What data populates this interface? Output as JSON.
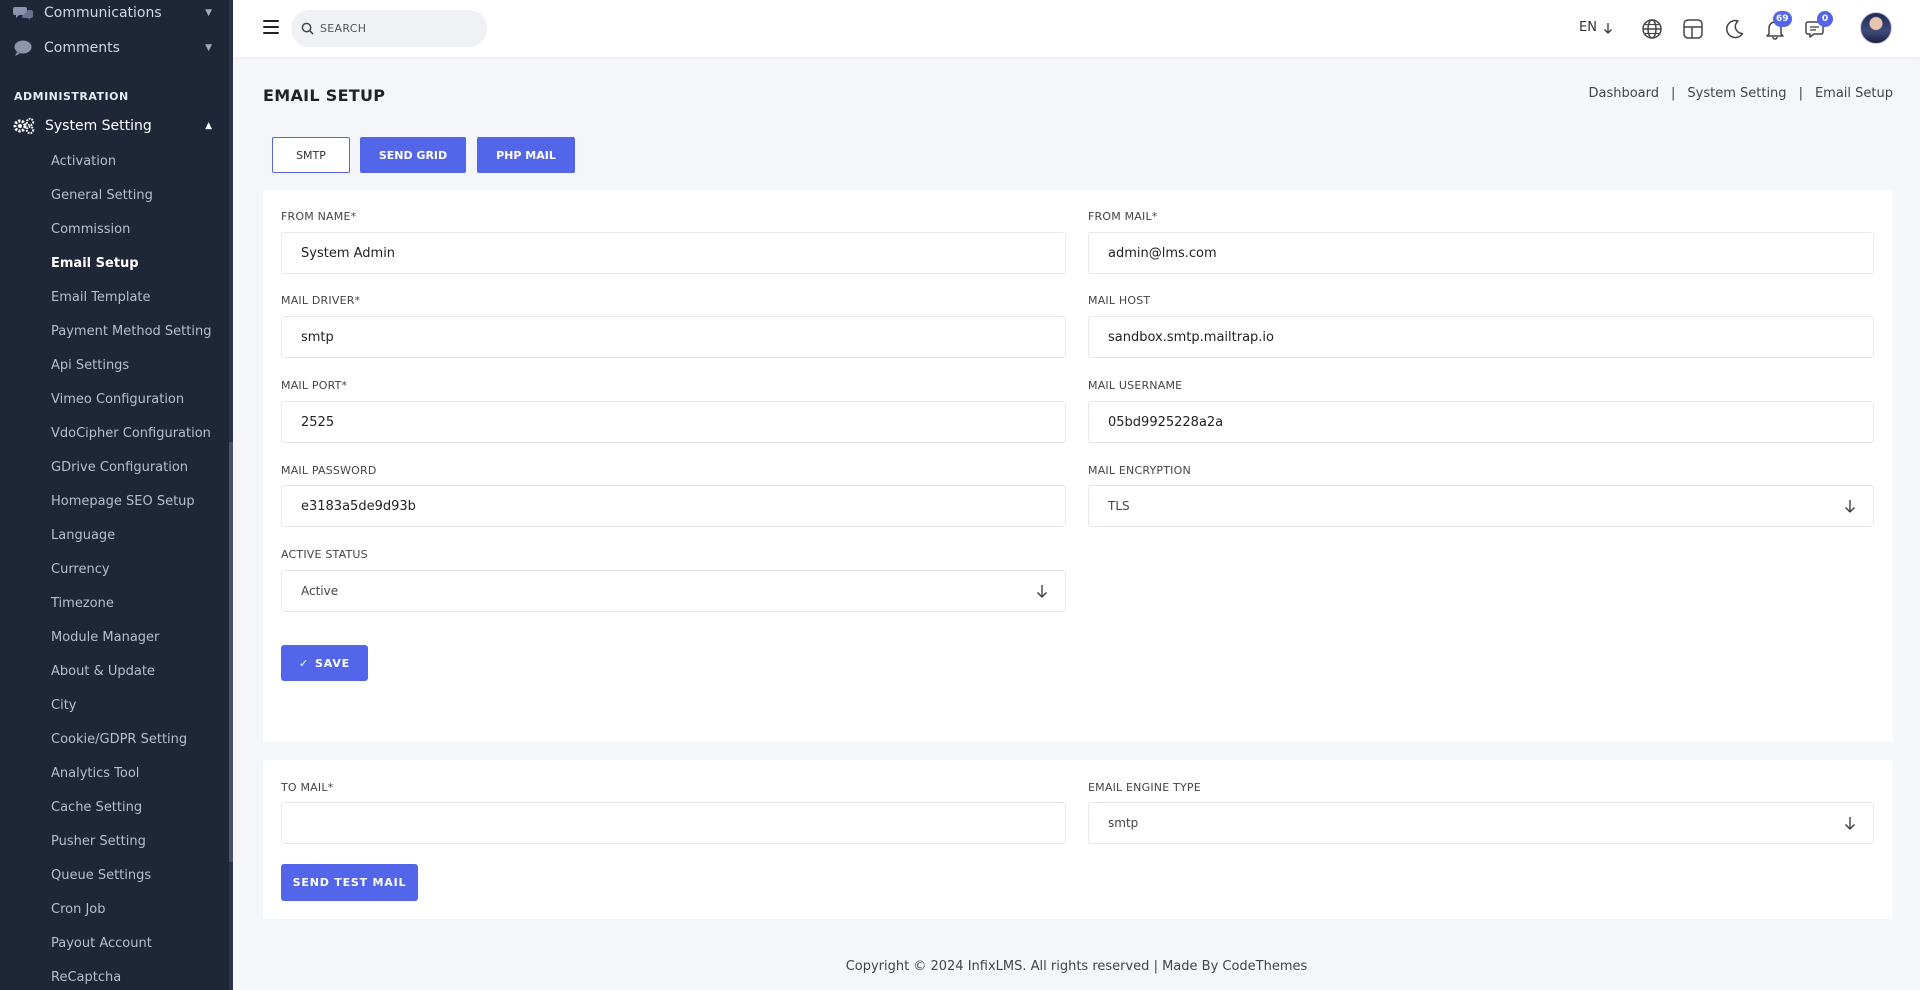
{
  "sidebar": {
    "top_items": [
      {
        "label": "Communications",
        "icon": "chat-bubbles-icon"
      },
      {
        "label": "Comments",
        "icon": "comment-icon"
      }
    ],
    "section_label": "ADMINISTRATION",
    "parent": {
      "label": "System Setting",
      "icon": "gears-icon"
    },
    "items": [
      {
        "label": "Activation"
      },
      {
        "label": "General Setting"
      },
      {
        "label": "Commission"
      },
      {
        "label": "Email Setup",
        "active": true
      },
      {
        "label": "Email Template"
      },
      {
        "label": "Payment Method Setting"
      },
      {
        "label": "Api Settings"
      },
      {
        "label": "Vimeo Configuration"
      },
      {
        "label": "VdoCipher Configuration"
      },
      {
        "label": "GDrive Configuration"
      },
      {
        "label": "Homepage SEO Setup"
      },
      {
        "label": "Language"
      },
      {
        "label": "Currency"
      },
      {
        "label": "Timezone"
      },
      {
        "label": "Module Manager"
      },
      {
        "label": "About & Update"
      },
      {
        "label": "City"
      },
      {
        "label": "Cookie/GDPR Setting"
      },
      {
        "label": "Analytics Tool"
      },
      {
        "label": "Cache Setting"
      },
      {
        "label": "Pusher Setting"
      },
      {
        "label": "Queue Settings"
      },
      {
        "label": "Cron Job"
      },
      {
        "label": "Payout Account"
      },
      {
        "label": "ReCaptcha"
      }
    ]
  },
  "header": {
    "search_placeholder": "SEARCH",
    "language": "EN",
    "notifications_count": "69",
    "messages_count": "0"
  },
  "page": {
    "title": "EMAIL SETUP",
    "breadcrumb": [
      "Dashboard",
      "System Setting",
      "Email Setup"
    ]
  },
  "tabs": [
    {
      "label": "SMTP",
      "style": "outline"
    },
    {
      "label": "SEND GRID",
      "style": "filled"
    },
    {
      "label": "PHP MAIL",
      "style": "filled"
    }
  ],
  "form": {
    "from_name": {
      "label": "FROM NAME*",
      "value": "System Admin"
    },
    "from_mail": {
      "label": "FROM MAIL*",
      "value": "admin@lms.com"
    },
    "mail_driver": {
      "label": "MAIL DRIVER*",
      "value": "smtp"
    },
    "mail_host": {
      "label": "MAIL HOST",
      "value": "sandbox.smtp.mailtrap.io"
    },
    "mail_port": {
      "label": "MAIL PORT*",
      "value": "2525"
    },
    "mail_username": {
      "label": "MAIL USERNAME",
      "value": "05bd9925228a2a"
    },
    "mail_password": {
      "label": "MAIL PASSWORD",
      "value": "e3183a5de9d93b"
    },
    "mail_encryption": {
      "label": "MAIL ENCRYPTION",
      "value": "TLS"
    },
    "active_status": {
      "label": "ACTIVE STATUS",
      "value": "Active"
    },
    "save_label": "SAVE"
  },
  "test_mail": {
    "to_mail": {
      "label": "TO MAIL*",
      "value": ""
    },
    "engine_type": {
      "label": "EMAIL ENGINE TYPE",
      "value": "smtp"
    },
    "send_label": "SEND TEST MAIL"
  },
  "footer": {
    "text": "Copyright © 2024 InfixLMS. All rights reserved | Made By CodeThemes"
  },
  "colors": {
    "accent": "#5365e9",
    "sidebar_bg": "#1f2638"
  }
}
